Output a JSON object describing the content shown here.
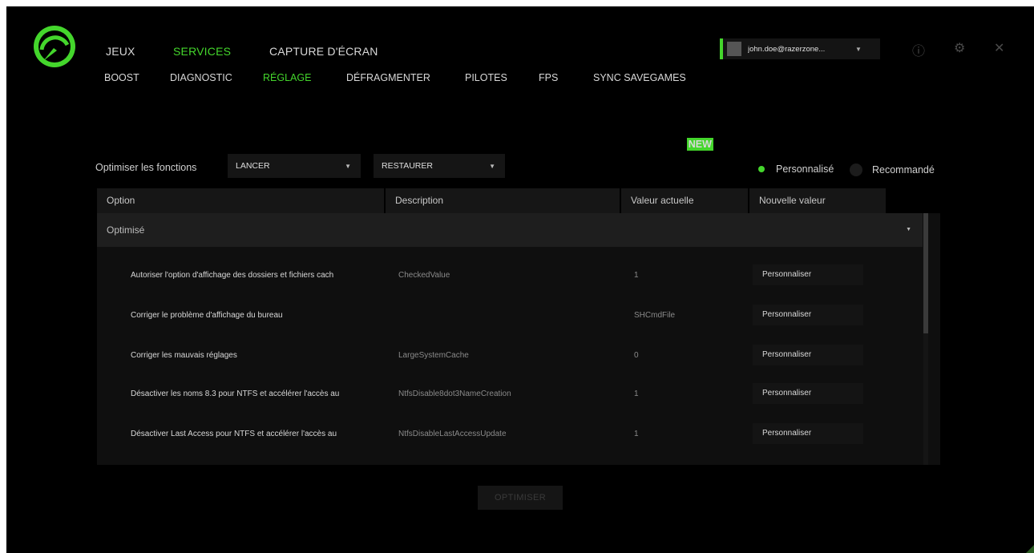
{
  "nav": {
    "main": [
      "JEUX",
      "SERVICES",
      "CAPTURE D'ÉCRAN"
    ],
    "main_active": "SERVICES",
    "sub": [
      "BOOST",
      "DIAGNOSTIC",
      "RÉGLAGE",
      "DÉFRAGMENTER",
      "PILOTES",
      "FPS",
      "SYNC SAVEGAMES"
    ],
    "sub_active": "RÉGLAGE",
    "new_badge": "NEW"
  },
  "user": {
    "email": "john.doe@razerzone..."
  },
  "window_icons": [
    "info-icon",
    "gear-icon",
    "close-icon"
  ],
  "toolbar": {
    "label": "Optimiser les fonctions",
    "launch_select": "LANCER",
    "restore_select": "RESTAURER",
    "radio_custom": "Personnalisé",
    "radio_recommended": "Recommandé",
    "selected_mode": "Personnalisé"
  },
  "table": {
    "headers": [
      "Option",
      "Description",
      "Valeur actuelle",
      "Nouvelle valeur"
    ],
    "group": "Optimisé",
    "rows": [
      {
        "option": "Autoriser l'option d'affichage des dossiers et fichiers cach",
        "description": "CheckedValue",
        "current": "1",
        "new": "Personnaliser"
      },
      {
        "option": "Corriger le problème d'affichage du bureau",
        "description": "",
        "current": "SHCmdFile",
        "new": "Personnaliser"
      },
      {
        "option": "Corriger les mauvais réglages",
        "description": "LargeSystemCache",
        "current": "0",
        "new": "Personnaliser"
      },
      {
        "option": "Désactiver les noms 8.3 pour NTFS et accélérer l'accès au",
        "description": "NtfsDisable8dot3NameCreation",
        "current": "1",
        "new": "Personnaliser"
      },
      {
        "option": "Désactiver Last Access pour NTFS et accélérer l'accès au",
        "description": "NtfsDisableLastAccessUpdate",
        "current": "1",
        "new": "Personnaliser"
      }
    ]
  },
  "optimize_button": "OPTIMISER",
  "colors": {
    "accent": "#44d62c",
    "background": "#000000",
    "panel": "#161616"
  }
}
